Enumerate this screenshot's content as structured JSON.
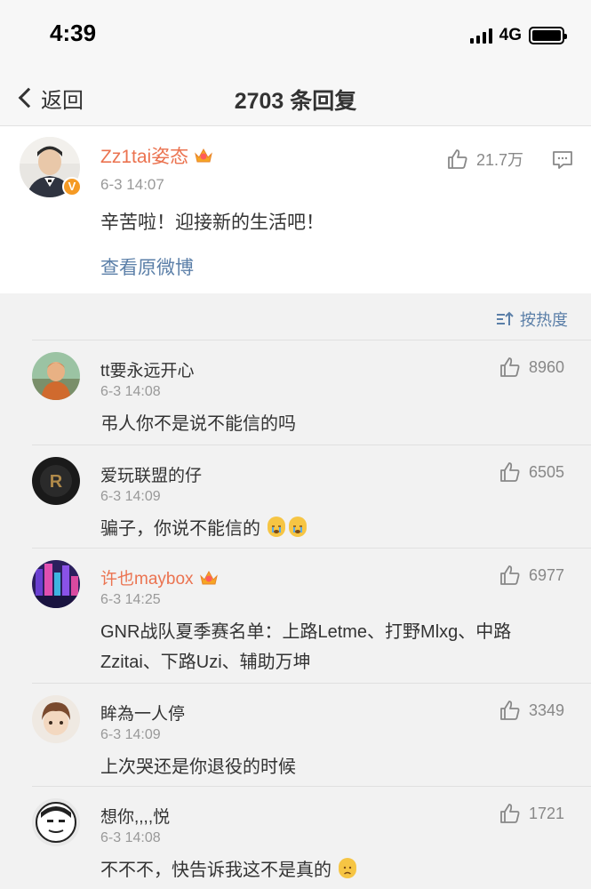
{
  "status_bar": {
    "time": "4:39",
    "network": "4G"
  },
  "nav": {
    "back_label": "返回",
    "title": "2703 条回复"
  },
  "main_post": {
    "username": "Zz1tai姿态",
    "timestamp": "6-3 14:07",
    "text": "辛苦啦！迎接新的生活吧！",
    "view_original": "查看原微博",
    "like_count": "21.7万",
    "verified_badge": "V"
  },
  "sort": {
    "label": "按热度"
  },
  "replies": [
    {
      "username": "tt要永远开心",
      "timestamp": "6-3 14:08",
      "text": "弔人你不是说不能信的吗",
      "likes": "8960"
    },
    {
      "username": "爱玩联盟的仔",
      "timestamp": "6-3 14:09",
      "text": "骗子，你说不能信的",
      "likes": "6505"
    },
    {
      "username": "许也maybox",
      "timestamp": "6-3 14:25",
      "text": "GNR战队夏季赛名单：上路Letme、打野Mlxg、中路Zzitai、下路Uzi、辅助万坤",
      "likes": "6977"
    },
    {
      "username": "眸為一人停",
      "timestamp": "6-3 14:09",
      "text": "上次哭还是你退役的时候",
      "likes": "3349"
    },
    {
      "username": "想你,,,,悦",
      "timestamp": "6-3 14:08",
      "text": "不不不，快告诉我这不是真的",
      "likes": "1721"
    }
  ],
  "colors": {
    "accent_orange": "#eb7350",
    "link_blue": "#5b7fa8",
    "background": "#f2f2f2"
  }
}
